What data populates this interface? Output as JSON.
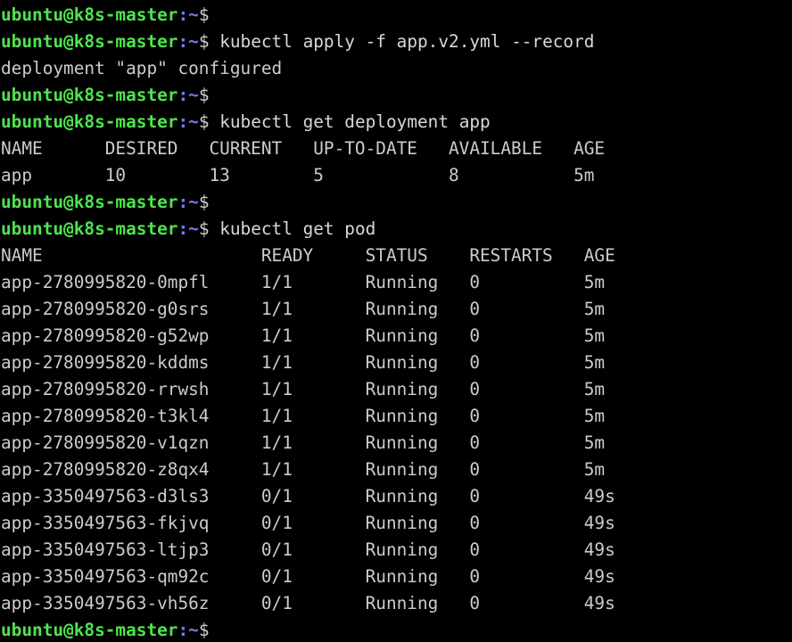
{
  "terminal": {
    "title": "ubuntu@k8s-master terminal",
    "background_color": "#000000",
    "foreground_color": "#d0d0d0",
    "prompt_user_color": "#4ee44e",
    "prompt_punct_color": "#7a7aff",
    "columns": 62,
    "rows": 24
  },
  "prompt": {
    "user_host": "ubuntu@k8s-master",
    "punct": ":~",
    "dollar": "$"
  },
  "lines": [
    {
      "type": "prompt",
      "command": ""
    },
    {
      "type": "prompt",
      "command": " kubectl apply -f app.v2.yml --record"
    },
    {
      "type": "output",
      "text": "deployment \"app\" configured"
    },
    {
      "type": "prompt",
      "command": ""
    },
    {
      "type": "prompt",
      "command": " kubectl get deployment app"
    },
    {
      "type": "output",
      "text": "NAME      DESIRED   CURRENT   UP-TO-DATE   AVAILABLE   AGE"
    },
    {
      "type": "output",
      "text": "app       10        13        5            8           5m"
    },
    {
      "type": "prompt",
      "command": ""
    },
    {
      "type": "prompt",
      "command": " kubectl get pod"
    },
    {
      "type": "output",
      "text": "NAME                     READY     STATUS    RESTARTS   AGE"
    },
    {
      "type": "output",
      "text": "app-2780995820-0mpfl     1/1       Running   0          5m"
    },
    {
      "type": "output",
      "text": "app-2780995820-g0srs     1/1       Running   0          5m"
    },
    {
      "type": "output",
      "text": "app-2780995820-g52wp     1/1       Running   0          5m"
    },
    {
      "type": "output",
      "text": "app-2780995820-kddms     1/1       Running   0          5m"
    },
    {
      "type": "output",
      "text": "app-2780995820-rrwsh     1/1       Running   0          5m"
    },
    {
      "type": "output",
      "text": "app-2780995820-t3kl4     1/1       Running   0          5m"
    },
    {
      "type": "output",
      "text": "app-2780995820-v1qzn     1/1       Running   0          5m"
    },
    {
      "type": "output",
      "text": "app-2780995820-z8qx4     1/1       Running   0          5m"
    },
    {
      "type": "output",
      "text": "app-3350497563-d3ls3     0/1       Running   0          49s"
    },
    {
      "type": "output",
      "text": "app-3350497563-fkjvq     0/1       Running   0          49s"
    },
    {
      "type": "output",
      "text": "app-3350497563-ltjp3     0/1       Running   0          49s"
    },
    {
      "type": "output",
      "text": "app-3350497563-qm92c     0/1       Running   0          49s"
    },
    {
      "type": "output",
      "text": "app-3350497563-vh56z     0/1       Running   0          49s"
    },
    {
      "type": "prompt",
      "command": ""
    }
  ],
  "commands": {
    "apply": "kubectl apply -f app.v2.yml --record",
    "get_deployment": "kubectl get deployment app",
    "get_pod": "kubectl get pod"
  },
  "deployment_result_message": "deployment \"app\" configured",
  "deployment_table": {
    "headers": [
      "NAME",
      "DESIRED",
      "CURRENT",
      "UP-TO-DATE",
      "AVAILABLE",
      "AGE"
    ],
    "rows": [
      [
        "app",
        "10",
        "13",
        "5",
        "8",
        "5m"
      ]
    ]
  },
  "pod_table": {
    "headers": [
      "NAME",
      "READY",
      "STATUS",
      "RESTARTS",
      "AGE"
    ],
    "rows": [
      [
        "app-2780995820-0mpfl",
        "1/1",
        "Running",
        "0",
        "5m"
      ],
      [
        "app-2780995820-g0srs",
        "1/1",
        "Running",
        "0",
        "5m"
      ],
      [
        "app-2780995820-g52wp",
        "1/1",
        "Running",
        "0",
        "5m"
      ],
      [
        "app-2780995820-kddms",
        "1/1",
        "Running",
        "0",
        "5m"
      ],
      [
        "app-2780995820-rrwsh",
        "1/1",
        "Running",
        "0",
        "5m"
      ],
      [
        "app-2780995820-t3kl4",
        "1/1",
        "Running",
        "0",
        "5m"
      ],
      [
        "app-2780995820-v1qzn",
        "1/1",
        "Running",
        "0",
        "5m"
      ],
      [
        "app-2780995820-z8qx4",
        "1/1",
        "Running",
        "0",
        "5m"
      ],
      [
        "app-3350497563-d3ls3",
        "0/1",
        "Running",
        "0",
        "49s"
      ],
      [
        "app-3350497563-fkjvq",
        "0/1",
        "Running",
        "0",
        "49s"
      ],
      [
        "app-3350497563-ltjp3",
        "0/1",
        "Running",
        "0",
        "49s"
      ],
      [
        "app-3350497563-qm92c",
        "0/1",
        "Running",
        "0",
        "49s"
      ],
      [
        "app-3350497563-vh56z",
        "0/1",
        "Running",
        "0",
        "49s"
      ]
    ]
  }
}
